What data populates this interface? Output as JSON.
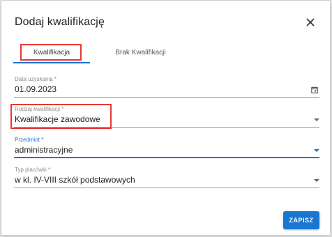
{
  "dialog": {
    "title": "Dodaj kwalifikację"
  },
  "tabs": [
    {
      "label": "Kwalifikacja",
      "active": true
    },
    {
      "label": "Brak Kwalifikacji",
      "active": false
    }
  ],
  "form": {
    "date": {
      "label": "Data uzyskania *",
      "value": "01.09.2023"
    },
    "qualification_type": {
      "label": "Rodzaj kwalifikacji *",
      "value": "Kwalifikacje zawodowe"
    },
    "subject": {
      "label": "Przedmiot *",
      "value": "administracyjne",
      "focused": true
    },
    "facility_type": {
      "label": "Typ placówki *",
      "value": "w kl. IV-VIII szkół podstawowych"
    }
  },
  "actions": {
    "save_label": "ZAPISZ"
  },
  "icons": {
    "close": "close-icon",
    "calendar": "calendar-icon",
    "dropdown": "chevron-down-icon"
  },
  "colors": {
    "accent": "#1976d2",
    "highlight": "#e53935"
  }
}
